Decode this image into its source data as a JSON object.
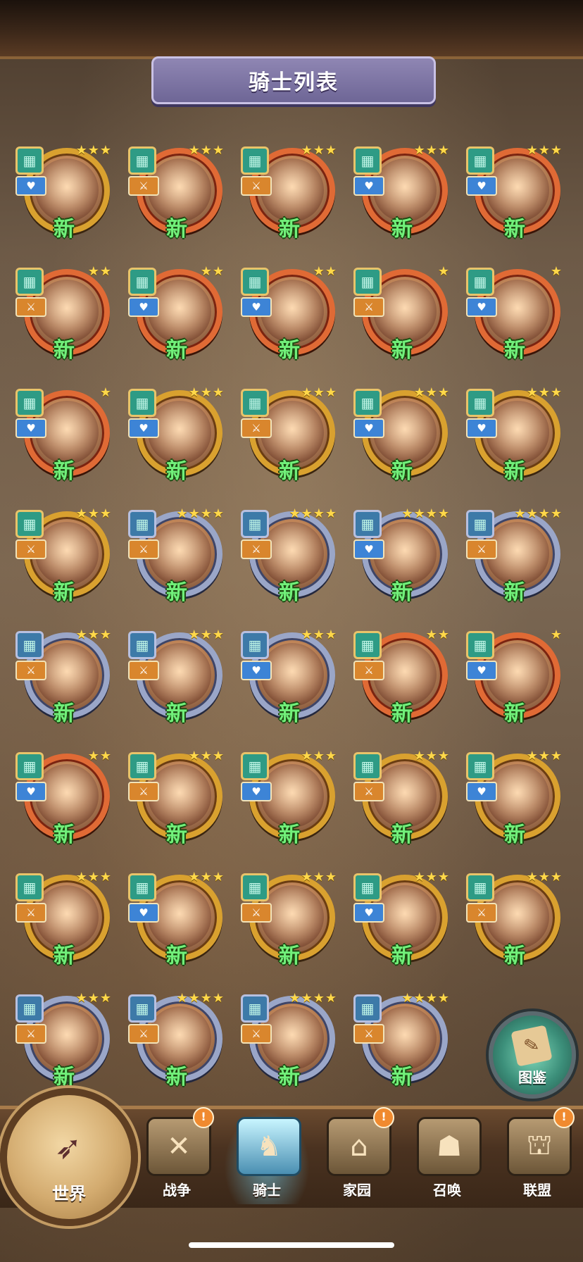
{
  "title": "骑士列表",
  "new_label": "新",
  "codex_label": "图鉴",
  "world_label": "世界",
  "tabs": [
    {
      "label": "战争",
      "icon": "map-icon",
      "alert": "!"
    },
    {
      "label": "骑士",
      "icon": "knight-icon",
      "alert": ""
    },
    {
      "label": "家园",
      "icon": "house-icon",
      "alert": "!"
    },
    {
      "label": "召唤",
      "icon": "train-icon",
      "alert": ""
    },
    {
      "label": "联盟",
      "icon": "guild-icon",
      "alert": "!"
    }
  ],
  "knights": [
    {
      "stars": 3,
      "frame": "gold",
      "badge": "gold",
      "tag": "blue",
      "is_new": true
    },
    {
      "stars": 3,
      "frame": "red",
      "badge": "gold",
      "tag": "orange",
      "is_new": true
    },
    {
      "stars": 3,
      "frame": "red",
      "badge": "gold",
      "tag": "orange",
      "is_new": true
    },
    {
      "stars": 3,
      "frame": "red",
      "badge": "gold",
      "tag": "blue",
      "is_new": true
    },
    {
      "stars": 3,
      "frame": "red",
      "badge": "gold",
      "tag": "blue",
      "is_new": true
    },
    {
      "stars": 2,
      "frame": "red",
      "badge": "gold",
      "tag": "orange",
      "is_new": true
    },
    {
      "stars": 2,
      "frame": "red",
      "badge": "gold",
      "tag": "blue",
      "is_new": true
    },
    {
      "stars": 2,
      "frame": "red",
      "badge": "gold",
      "tag": "blue",
      "is_new": true
    },
    {
      "stars": 1,
      "frame": "red",
      "badge": "gold",
      "tag": "orange",
      "is_new": true
    },
    {
      "stars": 1,
      "frame": "red",
      "badge": "gold",
      "tag": "blue",
      "is_new": true
    },
    {
      "stars": 1,
      "frame": "red",
      "badge": "gold",
      "tag": "blue",
      "is_new": true
    },
    {
      "stars": 3,
      "frame": "gold",
      "badge": "gold",
      "tag": "blue",
      "is_new": true
    },
    {
      "stars": 3,
      "frame": "gold",
      "badge": "gold",
      "tag": "orange",
      "is_new": true
    },
    {
      "stars": 3,
      "frame": "gold",
      "badge": "gold",
      "tag": "blue",
      "is_new": true
    },
    {
      "stars": 3,
      "frame": "gold",
      "badge": "gold",
      "tag": "blue",
      "is_new": true
    },
    {
      "stars": 3,
      "frame": "gold",
      "badge": "gold",
      "tag": "orange",
      "is_new": true
    },
    {
      "stars": 4,
      "frame": "silver",
      "badge": "silver",
      "tag": "orange",
      "is_new": true
    },
    {
      "stars": 4,
      "frame": "silver",
      "badge": "silver",
      "tag": "orange",
      "is_new": true
    },
    {
      "stars": 4,
      "frame": "silver",
      "badge": "silver",
      "tag": "blue",
      "is_new": true
    },
    {
      "stars": 4,
      "frame": "silver",
      "badge": "silver",
      "tag": "orange",
      "is_new": true
    },
    {
      "stars": 3,
      "frame": "silver",
      "badge": "silver",
      "tag": "orange",
      "is_new": true
    },
    {
      "stars": 3,
      "frame": "silver",
      "badge": "silver",
      "tag": "orange",
      "is_new": true
    },
    {
      "stars": 3,
      "frame": "silver",
      "badge": "silver",
      "tag": "blue",
      "is_new": true
    },
    {
      "stars": 2,
      "frame": "red",
      "badge": "gold",
      "tag": "orange",
      "is_new": true
    },
    {
      "stars": 1,
      "frame": "red",
      "badge": "gold",
      "tag": "blue",
      "is_new": true
    },
    {
      "stars": 2,
      "frame": "red",
      "badge": "gold",
      "tag": "blue",
      "is_new": true
    },
    {
      "stars": 3,
      "frame": "gold",
      "badge": "gold",
      "tag": "orange",
      "is_new": true
    },
    {
      "stars": 3,
      "frame": "gold",
      "badge": "gold",
      "tag": "blue",
      "is_new": true
    },
    {
      "stars": 3,
      "frame": "gold",
      "badge": "gold",
      "tag": "orange",
      "is_new": true
    },
    {
      "stars": 3,
      "frame": "gold",
      "badge": "gold",
      "tag": "blue",
      "is_new": true
    },
    {
      "stars": 3,
      "frame": "gold",
      "badge": "gold",
      "tag": "orange",
      "is_new": true
    },
    {
      "stars": 3,
      "frame": "gold",
      "badge": "gold",
      "tag": "blue",
      "is_new": true
    },
    {
      "stars": 3,
      "frame": "gold",
      "badge": "gold",
      "tag": "orange",
      "is_new": true
    },
    {
      "stars": 3,
      "frame": "gold",
      "badge": "gold",
      "tag": "blue",
      "is_new": true
    },
    {
      "stars": 3,
      "frame": "gold",
      "badge": "gold",
      "tag": "orange",
      "is_new": true
    },
    {
      "stars": 3,
      "frame": "silver",
      "badge": "silver",
      "tag": "orange",
      "is_new": true
    },
    {
      "stars": 4,
      "frame": "silver",
      "badge": "silver",
      "tag": "orange",
      "is_new": true
    },
    {
      "stars": 4,
      "frame": "silver",
      "badge": "silver",
      "tag": "orange",
      "is_new": true
    },
    {
      "stars": 4,
      "frame": "silver",
      "badge": "silver",
      "tag": "orange",
      "is_new": true
    }
  ],
  "colors": {
    "new_text": "#71f07a",
    "gold_frame": "#d9a12f",
    "silver_frame": "#9aa6c8",
    "red_frame": "#e06a35",
    "title_banner": "#7f77a6"
  }
}
